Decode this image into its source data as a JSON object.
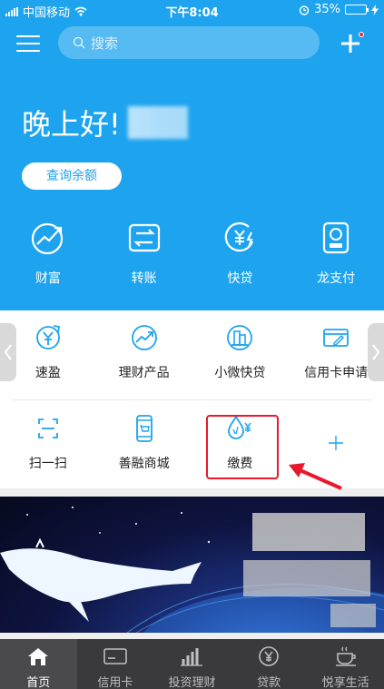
{
  "status_bar": {
    "carrier": "中国移动",
    "time": "下午8:04",
    "battery": "35%",
    "battery_level": 0.35
  },
  "header": {
    "search_placeholder": "搜索",
    "greeting": "晚上好!",
    "balance_button": "查询余额"
  },
  "hero_items": [
    {
      "label": "财富",
      "icon": "wealth-icon"
    },
    {
      "label": "转账",
      "icon": "transfer-icon"
    },
    {
      "label": "快贷",
      "icon": "quick-loan-icon"
    },
    {
      "label": "龙支付",
      "icon": "long-pay-icon"
    }
  ],
  "services_row1": [
    {
      "label": "速盈",
      "icon": "yen-refresh-icon"
    },
    {
      "label": "理财产品",
      "icon": "trend-icon"
    },
    {
      "label": "小微快贷",
      "icon": "building-icon"
    },
    {
      "label": "信用卡申请",
      "icon": "card-edit-icon"
    }
  ],
  "services_row2": [
    {
      "label": "扫一扫",
      "icon": "scan-icon"
    },
    {
      "label": "善融商城",
      "icon": "phone-shop-icon"
    },
    {
      "label": "缴费",
      "icon": "water-yen-icon"
    },
    {
      "label": "",
      "icon": "add-icon"
    }
  ],
  "tabs": [
    {
      "label": "首页",
      "icon": "home-icon",
      "active": true
    },
    {
      "label": "信用卡",
      "icon": "credit-card-icon"
    },
    {
      "label": "投资理财",
      "icon": "bar-chart-icon"
    },
    {
      "label": "贷款",
      "icon": "yen-circle-icon"
    },
    {
      "label": "悦享生活",
      "icon": "coffee-icon"
    }
  ],
  "colors": {
    "brand_blue": "#1ea4ee",
    "highlight_red": "#e8192c",
    "tabbar_bg": "#3a3a3c"
  }
}
